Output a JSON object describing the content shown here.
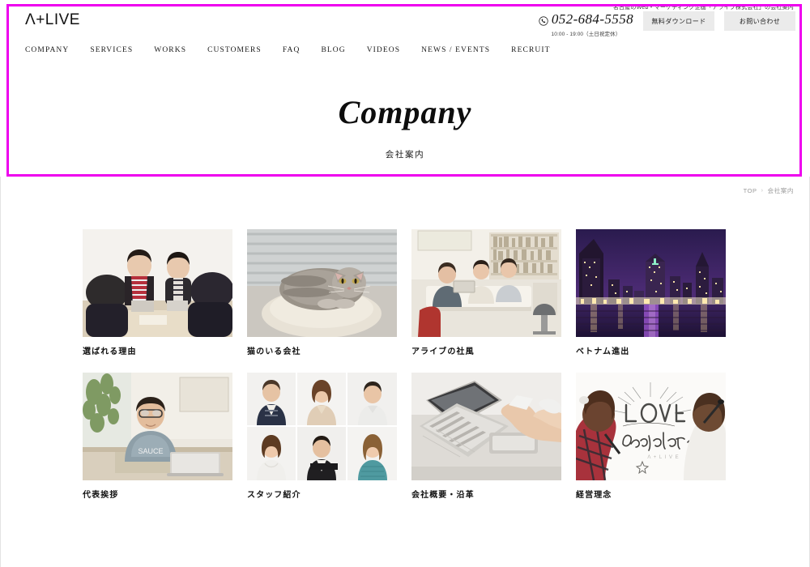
{
  "header": {
    "tagline": "名古屋のWeb・マーケティング企画「アライブ株式会社」の会社案内",
    "logo": "Λ+LIVE",
    "tel": "052-684-5558",
    "tel_icon": "phone-icon",
    "tel_hours": "10:00 - 19:00（土日祝定休）",
    "btn_download": "無料ダウンロード",
    "btn_contact": "お問い合わせ"
  },
  "nav": {
    "items": [
      {
        "label": "COMPANY"
      },
      {
        "label": "SERVICES"
      },
      {
        "label": "WORKS"
      },
      {
        "label": "CUSTOMERS"
      },
      {
        "label": "FAQ"
      },
      {
        "label": "BLOG"
      },
      {
        "label": "VIDEOS"
      },
      {
        "label": "NEWS / EVENTS"
      },
      {
        "label": "RECRUIT"
      }
    ]
  },
  "hero": {
    "title": "Company",
    "subtitle": "会社案内",
    "divider": "–"
  },
  "breadcrumb": {
    "home": "TOP",
    "separator": "›",
    "current": "会社案内"
  },
  "cards": [
    {
      "title": "選ばれる理由",
      "image": "meeting-room-photo"
    },
    {
      "title": "猫のいる会社",
      "image": "cat-on-bed-photo"
    },
    {
      "title": "アライブの社風",
      "image": "office-team-photo"
    },
    {
      "title": "ベトナム進出",
      "image": "night-cityscape-photo"
    },
    {
      "title": "代表挨拶",
      "image": "ceo-portrait-photo"
    },
    {
      "title": "スタッフ紹介",
      "image": "staff-grid-photo"
    },
    {
      "title": "会社概要・沿革",
      "image": "laptop-desk-photo"
    },
    {
      "title": "経営理念",
      "image": "love-each-other-wall-photo"
    }
  ],
  "colors": {
    "highlight": "#ee00ee",
    "button_bg": "#ebebeb",
    "text": "#1c1c1c",
    "muted": "#9a9a9a"
  }
}
